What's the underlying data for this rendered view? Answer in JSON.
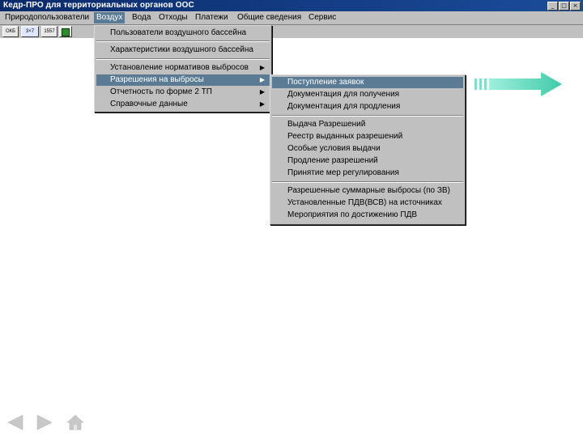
{
  "window": {
    "title": "Кедр-ПРО для территориальных органов ООС",
    "min_btn": "_",
    "max_btn": "□",
    "close_btn": "×"
  },
  "menubar": {
    "items": [
      {
        "label": "Природопользователи"
      },
      {
        "label": "Воздух"
      },
      {
        "label": "Вода"
      },
      {
        "label": "Отходы"
      },
      {
        "label": "Платежи"
      },
      {
        "label": "Общие сведения"
      },
      {
        "label": "Сервис"
      }
    ]
  },
  "toolbar": {
    "tools": [
      {
        "label": "ОКБ"
      },
      {
        "label": "3×7"
      },
      {
        "label": "1557"
      }
    ]
  },
  "air_menu": {
    "items": [
      {
        "label": "Пользователи воздушного бассейна"
      },
      {
        "label": "Характеристики воздушного бассейна"
      },
      {
        "label": "Установление нормативов выбросов",
        "arrow": "▶"
      },
      {
        "label": "Разрешения на выбросы",
        "arrow": "▶"
      },
      {
        "label": "Отчетность по форме 2 ТП",
        "arrow": "▶"
      },
      {
        "label": "Справочные данные",
        "arrow": "▶"
      }
    ]
  },
  "permits_menu": {
    "items": [
      {
        "label": "Поступление заявок"
      },
      {
        "label": "Документация для получения"
      },
      {
        "label": "Документация для продления"
      },
      {
        "label": "Выдача Разрешений"
      },
      {
        "label": "Реестр выданных разрешений"
      },
      {
        "label": "Особые условия выдачи"
      },
      {
        "label": "Продление разрешений"
      },
      {
        "label": "Принятие мер регулирования"
      },
      {
        "label": "Разрешенные суммарные выбросы (по ЗВ)"
      },
      {
        "label": "Установленные ПДВ(ВСВ) на источниках"
      },
      {
        "label": "Мероприятия по достижению ПДВ"
      }
    ]
  },
  "colors": {
    "highlight": "#5b7b94",
    "arrow_accent": "#4fd6b7",
    "nav_gray": "#c8c8c8"
  },
  "icons": {
    "next_arrow": "big-right-arrow",
    "back": "back-arrow-icon",
    "forward": "forward-arrow-icon",
    "home": "home-icon"
  }
}
